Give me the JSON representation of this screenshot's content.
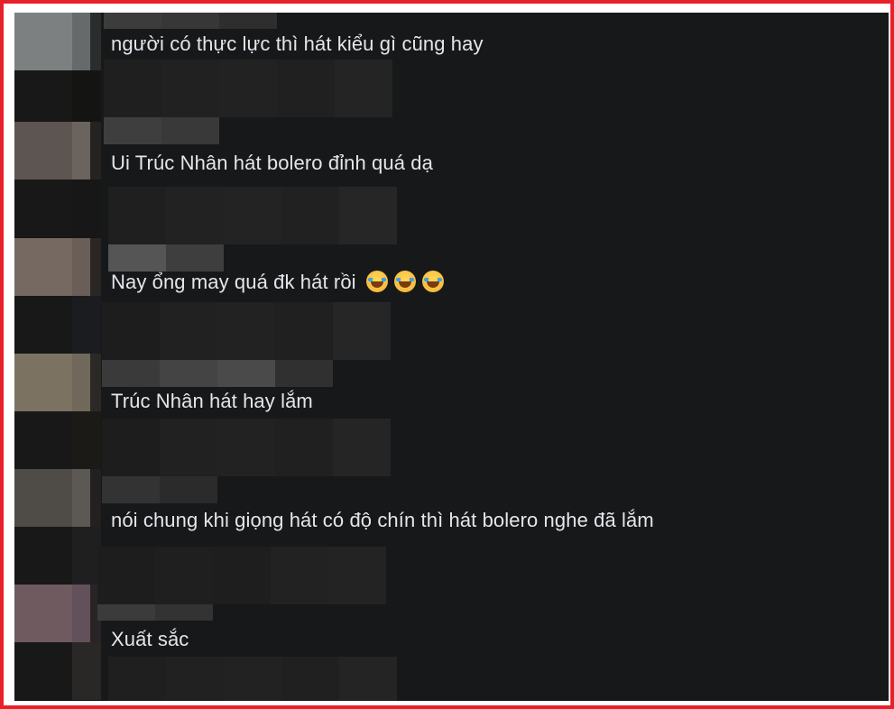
{
  "comments": [
    {
      "text": "người có thực lực thì hát kiểu gì cũng hay"
    },
    {
      "text": "Ui Trúc Nhân hát bolero đỉnh quá dạ"
    },
    {
      "text": "Nay ổng may quá đk hát rồi",
      "emojis": [
        "laughing-tears-icon",
        "laughing-tears-icon",
        "laughing-tears-icon"
      ]
    },
    {
      "text": "Trúc Nhân hát hay lắm"
    },
    {
      "text": "nói chung khi giọng hát có độ chín thì hát bolero nghe đã lắm"
    },
    {
      "text": "Xuất sắc"
    }
  ],
  "colors": {
    "frame_border": "#e8202a",
    "background": "#171819",
    "comment_text": "#e4e6eb"
  }
}
